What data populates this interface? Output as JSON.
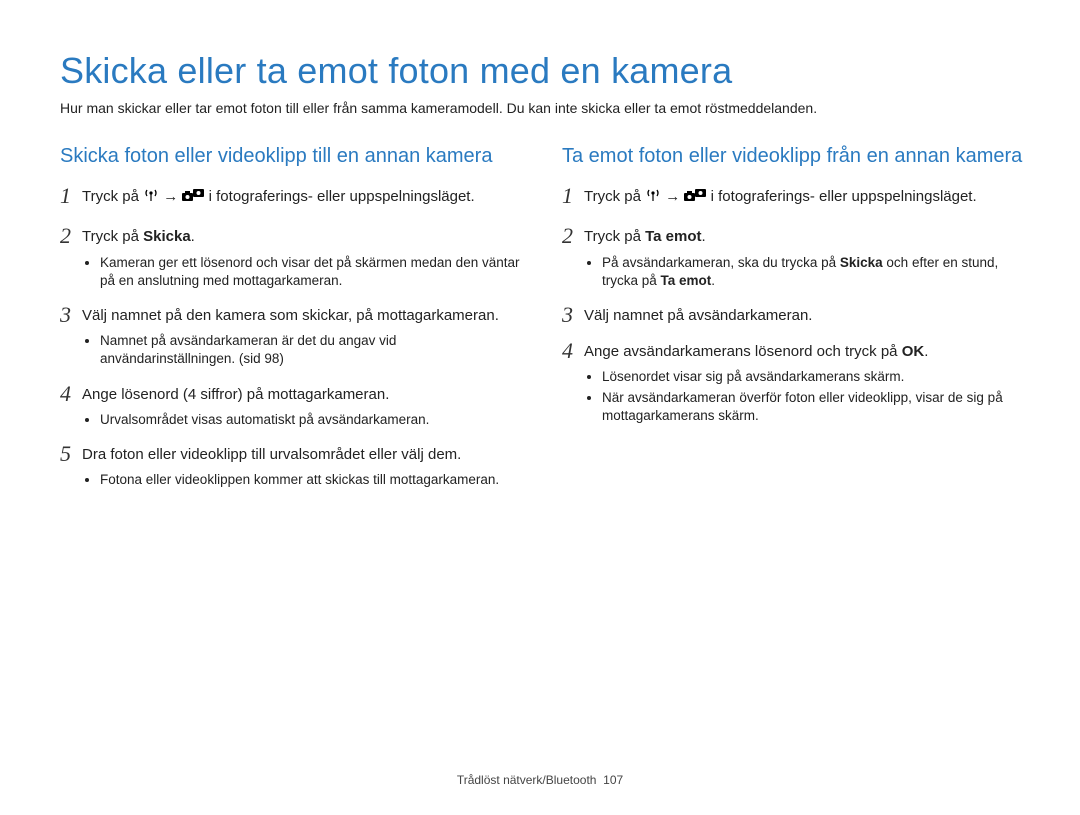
{
  "title": "Skicka eller ta emot foton med en kamera",
  "intro": "Hur man skickar eller tar emot foton till eller från samma kameramodell. Du kan inte skicka eller ta emot röstmeddelanden.",
  "arrow": "→",
  "left": {
    "heading": "Skicka foton eller videoklipp till en annan kamera",
    "steps": {
      "s1": {
        "num": "1",
        "pre": "Tryck på ",
        "post": " i fotograferings- eller uppspelningsläget."
      },
      "s2": {
        "num": "2",
        "pre": "Tryck på ",
        "bold": "Skicka",
        "post": ".",
        "bullets": [
          "Kameran ger ett lösenord och visar det på skärmen medan den väntar på en anslutning med mottagarkameran."
        ]
      },
      "s3": {
        "num": "3",
        "text": "Välj namnet på den kamera som skickar, på mottagarkameran.",
        "bullets": [
          "Namnet på avsändarkameran är det du angav vid användarinställningen. (sid 98)"
        ]
      },
      "s4": {
        "num": "4",
        "text": "Ange lösenord (4 siffror) på mottagarkameran.",
        "bullets": [
          "Urvalsområdet visas automatiskt på avsändarkameran."
        ]
      },
      "s5": {
        "num": "5",
        "text": "Dra foton eller videoklipp till urvalsområdet eller välj dem.",
        "bullets": [
          "Fotona eller videoklippen kommer att skickas till mottagarkameran."
        ]
      }
    }
  },
  "right": {
    "heading": "Ta emot foton eller videoklipp från en annan kamera",
    "steps": {
      "s1": {
        "num": "1",
        "pre": "Tryck på ",
        "post": " i fotograferings- eller uppspelningsläget."
      },
      "s2": {
        "num": "2",
        "pre": "Tryck på ",
        "bold": "Ta emot",
        "post": ".",
        "bullets_rich": [
          {
            "pre": "På avsändarkameran, ska du trycka på ",
            "b1": "Skicka",
            "mid": " och efter en stund, trycka på ",
            "b2": "Ta emot",
            "post": "."
          }
        ]
      },
      "s3": {
        "num": "3",
        "text": "Välj namnet på avsändarkameran."
      },
      "s4": {
        "num": "4",
        "pre": "Ange avsändarkamerans lösenord och tryck på ",
        "bold": "OK",
        "post": ".",
        "bullets": [
          "Lösenordet visar sig på avsändarkamerans skärm.",
          "När avsändarkameran överför foton eller videoklipp, visar de sig på mottagarkamerans skärm."
        ]
      }
    }
  },
  "footer": {
    "section": "Trådlöst nätverk/Bluetooth",
    "page": "107"
  }
}
